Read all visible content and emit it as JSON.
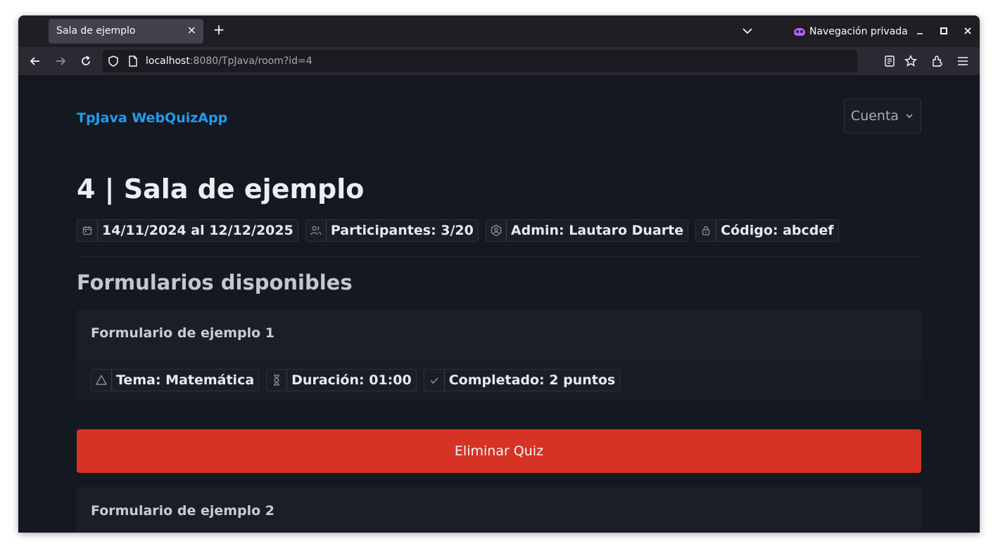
{
  "browser": {
    "tab_title": "Sala de ejemplo",
    "new_tab_label": "+",
    "private_label": "Navegación privada",
    "url_host": "localhost",
    "url_rest": ":8080/TpJava/room?id=4"
  },
  "navbar": {
    "brand": "TpJava WebQuizApp",
    "account_label": "Cuenta"
  },
  "room": {
    "title": "4 | Sala de ejemplo",
    "dates": "14/11/2024 al 12/12/2025",
    "participants": "Participantes: 3/20",
    "admin": "Admin: Lautaro Duarte",
    "code": "Código: abcdef"
  },
  "forms_section": {
    "title": "Formularios disponibles",
    "forms": [
      {
        "title": "Formulario de ejemplo 1",
        "topic": "Tema: Matemática",
        "duration": "Duración: 01:00",
        "status": "Completado: 2 puntos",
        "delete_label": "Eliminar Quiz"
      },
      {
        "title": "Formulario de ejemplo 2"
      }
    ]
  },
  "colors": {
    "brand": "#1f9cf0",
    "danger": "#d63325",
    "background": "#141820"
  }
}
